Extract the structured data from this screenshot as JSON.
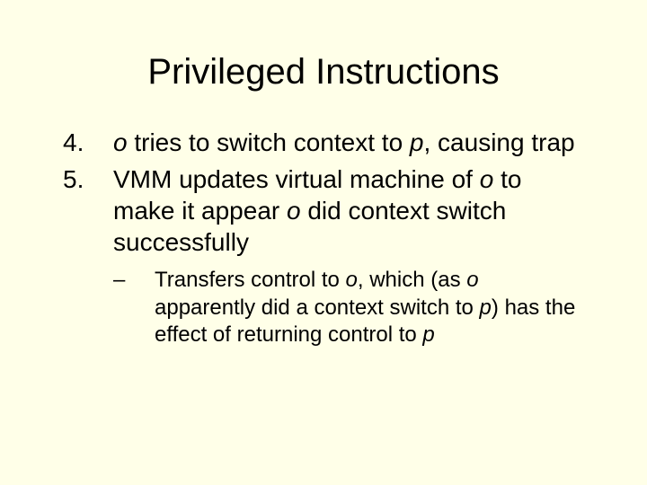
{
  "title": "Privileged Instructions",
  "items": [
    {
      "num": "4.",
      "segments": [
        {
          "t": "o",
          "i": true
        },
        {
          "t": " tries to switch context to ",
          "i": false
        },
        {
          "t": "p",
          "i": true
        },
        {
          "t": ", causing trap",
          "i": false
        }
      ]
    },
    {
      "num": "5.",
      "segments": [
        {
          "t": "VMM updates virtual machine of ",
          "i": false
        },
        {
          "t": "o",
          "i": true
        },
        {
          "t": " to make it appear ",
          "i": false
        },
        {
          "t": "o",
          "i": true
        },
        {
          "t": " did context switch successfully",
          "i": false
        }
      ]
    }
  ],
  "sub": {
    "dash": "–",
    "segments": [
      {
        "t": "Transfers control to ",
        "i": false
      },
      {
        "t": "o",
        "i": true
      },
      {
        "t": ", which (as ",
        "i": false
      },
      {
        "t": "o",
        "i": true
      },
      {
        "t": " apparently did a context switch to ",
        "i": false
      },
      {
        "t": "p",
        "i": true
      },
      {
        "t": ") has the effect of returning control to ",
        "i": false
      },
      {
        "t": "p",
        "i": true
      }
    ]
  }
}
